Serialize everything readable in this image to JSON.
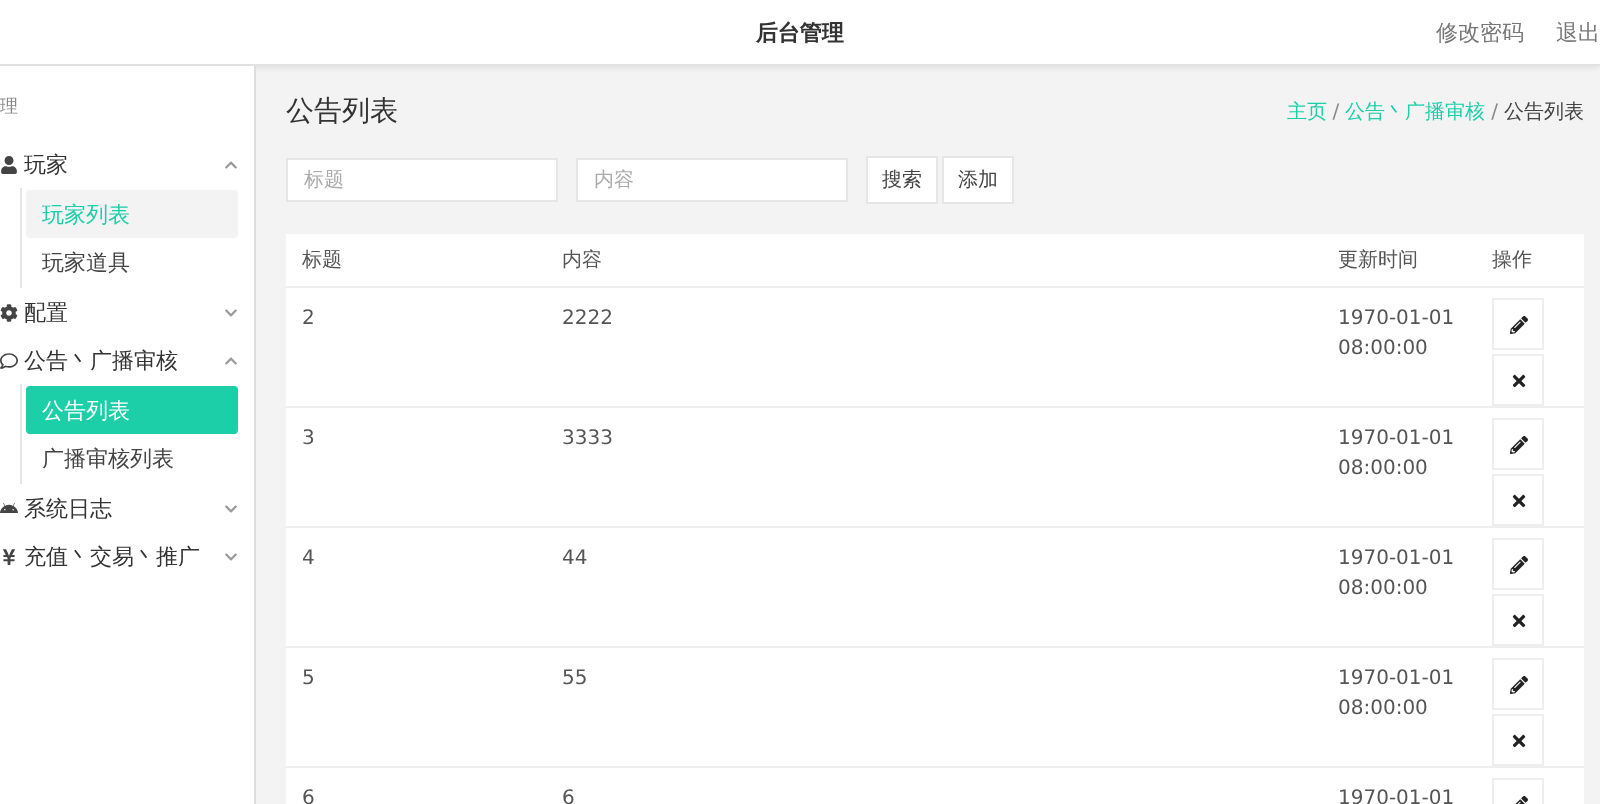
{
  "header": {
    "title": "后台管理",
    "links": [
      "修改密码",
      "退出"
    ]
  },
  "sidebar": {
    "heading": "理",
    "groups": [
      {
        "label": "玩家",
        "expanded": true,
        "children": [
          {
            "label": "玩家列表",
            "selected": false,
            "hovered": true
          },
          {
            "label": "玩家道具",
            "selected": false,
            "hovered": false
          }
        ]
      },
      {
        "label": "配置",
        "expanded": false
      },
      {
        "label": "公告丶广播审核",
        "expanded": true,
        "children": [
          {
            "label": "公告列表",
            "selected": true,
            "hovered": false
          },
          {
            "label": "广播审核列表",
            "selected": false,
            "hovered": false
          }
        ]
      },
      {
        "label": "系统日志",
        "expanded": false
      },
      {
        "label": "充值丶交易丶推广",
        "expanded": false
      }
    ]
  },
  "page": {
    "title": "公告列表",
    "separator": "/",
    "breadcrumb": [
      {
        "label": "主页",
        "link": true
      },
      {
        "label": "公告丶广播审核",
        "link": true
      },
      {
        "label": "公告列表",
        "link": false
      }
    ]
  },
  "search": {
    "fields": [
      {
        "placeholder": "标题"
      },
      {
        "placeholder": "内容"
      }
    ],
    "buttons": [
      "搜索",
      "添加"
    ]
  },
  "table": {
    "columns": [
      "标题",
      "内容",
      "更新时间",
      "操作"
    ],
    "rows": [
      {
        "title": "2",
        "content": "2222",
        "date": "1970-01-01",
        "time": "08:00:00"
      },
      {
        "title": "3",
        "content": "3333",
        "date": "1970-01-01",
        "time": "08:00:00"
      },
      {
        "title": "4",
        "content": "44",
        "date": "1970-01-01",
        "time": "08:00:00"
      },
      {
        "title": "5",
        "content": "55",
        "date": "1970-01-01",
        "time": "08:00:00"
      },
      {
        "title": "6",
        "content": "6",
        "date": "1970-01-01"
      }
    ]
  }
}
